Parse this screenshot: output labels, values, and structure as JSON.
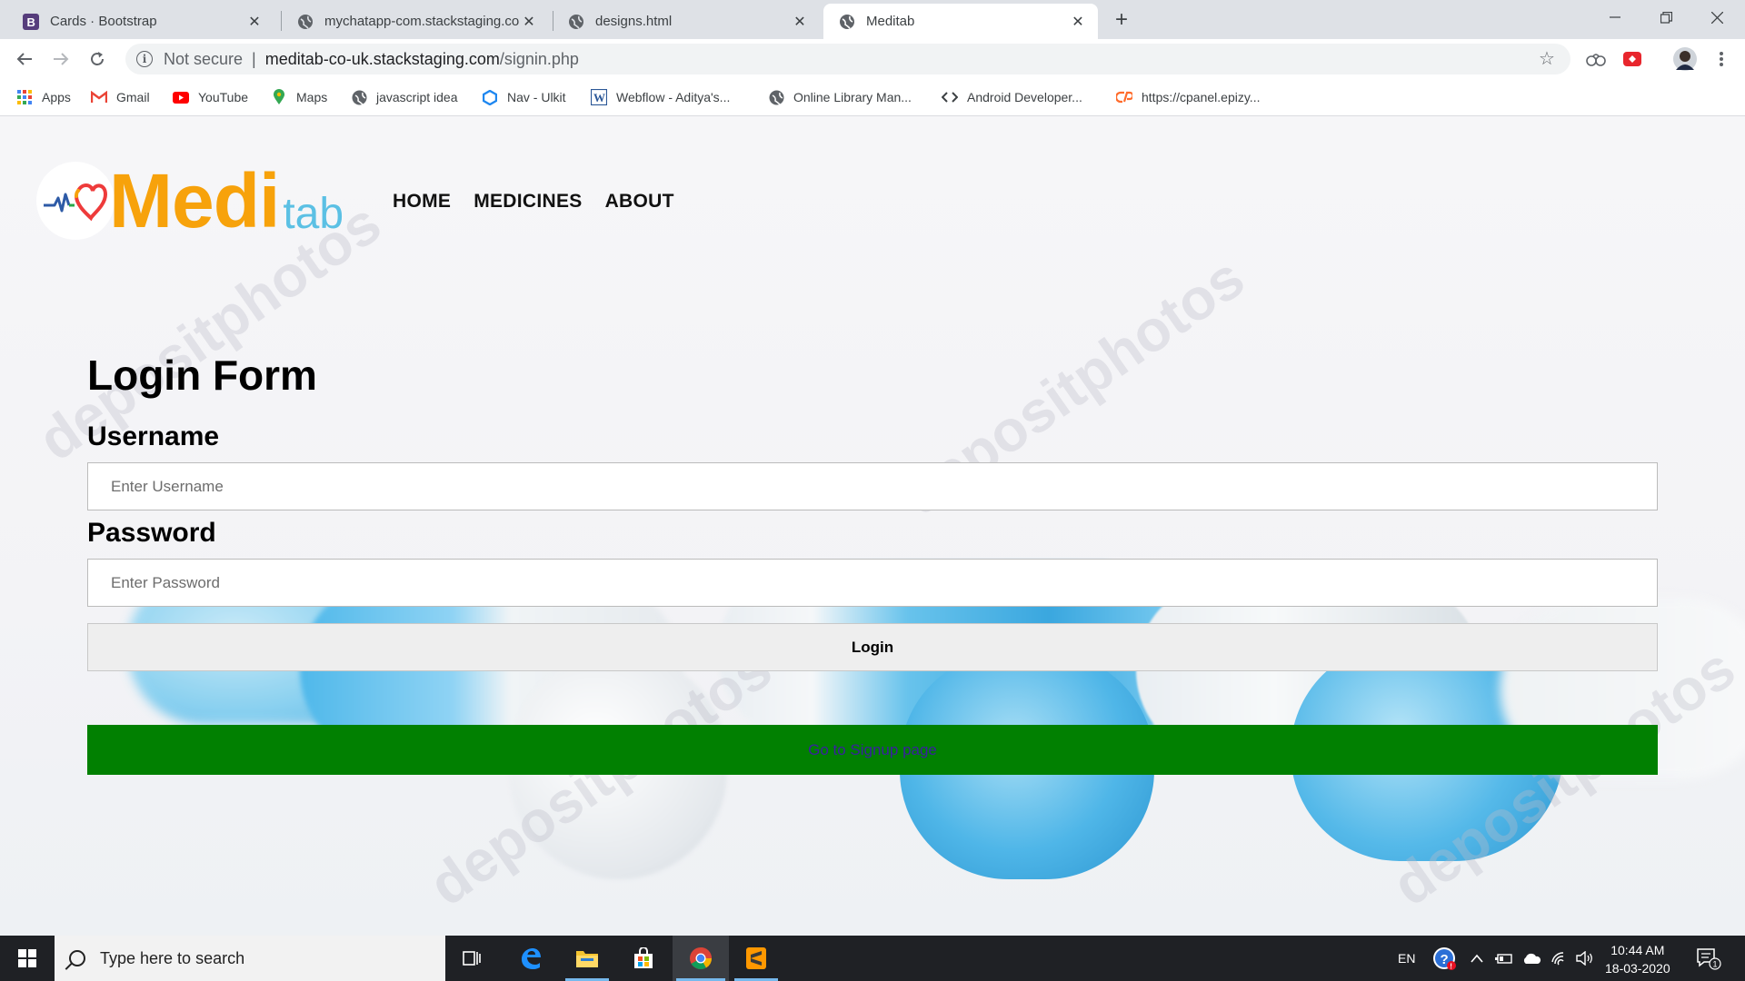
{
  "browser": {
    "tabs": [
      {
        "title": "Cards · Bootstrap",
        "icon": "bootstrap-icon",
        "active": false
      },
      {
        "title": "mychatapp-com.stackstaging.com",
        "icon": "globe-icon",
        "active": false
      },
      {
        "title": "designs.html",
        "icon": "globe-icon",
        "active": false
      },
      {
        "title": "Meditab",
        "icon": "globe-icon",
        "active": true
      }
    ],
    "address": {
      "security": "Not secure",
      "host": "meditab-co-uk.stackstaging.com",
      "path": "/signin.php"
    },
    "bookmarks": [
      {
        "label": "Apps",
        "icon": "apps-grid-icon"
      },
      {
        "label": "Gmail",
        "icon": "gmail-icon"
      },
      {
        "label": "YouTube",
        "icon": "youtube-icon"
      },
      {
        "label": "Maps",
        "icon": "maps-pin-icon"
      },
      {
        "label": "javascript idea",
        "icon": "globe-icon"
      },
      {
        "label": "Nav - Ulkit",
        "icon": "uikit-icon"
      },
      {
        "label": "Webflow - Aditya's...",
        "icon": "word-icon"
      },
      {
        "label": "Online Library Man...",
        "icon": "globe-icon"
      },
      {
        "label": "Android Developer...",
        "icon": "code-icon"
      },
      {
        "label": "https://cpanel.epizy...",
        "icon": "cpanel-icon"
      }
    ]
  },
  "site": {
    "logo": {
      "part1": "Medi",
      "part2": "tab"
    },
    "nav": [
      "HOME",
      "MEDICINES",
      "ABOUT"
    ],
    "watermark": "depositphotos"
  },
  "form": {
    "title": "Login Form",
    "username_label": "Username",
    "username_placeholder": "Enter Username",
    "password_label": "Password",
    "password_placeholder": "Enter Password",
    "login_label": "Login",
    "signup_link": "Go to Signup page"
  },
  "taskbar": {
    "search_placeholder": "Type here to search",
    "language": "EN",
    "time": "10:44 AM",
    "date": "18-03-2020",
    "notification_count": "1"
  },
  "colors": {
    "logo_orange": "#f7a20b",
    "logo_blue": "#5bc0e4",
    "signup_green": "#018001",
    "signup_link": "#3a1fa0"
  }
}
